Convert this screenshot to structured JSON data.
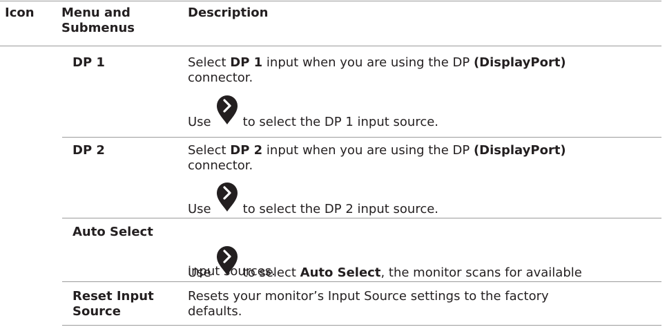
{
  "header": {
    "icon": "Icon",
    "menu": "Menu and Submenus",
    "description": "Description"
  },
  "rows": [
    {
      "menu": "DP 1",
      "desc1_pre": "Select ",
      "desc1_bold": "DP 1",
      "desc1_mid": " input when you are using the DP ",
      "desc1_bold2": "(DisplayPort)",
      "desc1_line2": "connector.",
      "use_pre": "Use",
      "use_post": "to select the DP 1 input source."
    },
    {
      "menu": "DP 2",
      "desc1_pre": "Select ",
      "desc1_bold": "DP 2",
      "desc1_mid": " input when you are using the DP ",
      "desc1_bold2": "(DisplayPort)",
      "desc1_line2": "connector.",
      "use_pre": "Use",
      "use_post": "to select the DP 2 input source."
    },
    {
      "menu": "Auto Select",
      "use_pre": "Use",
      "use_mid": "to select ",
      "use_bold": "Auto Select",
      "use_post": ", the monitor scans for available",
      "line2": "input sources."
    },
    {
      "menu_line1": "Reset Input",
      "menu_line2": "Source",
      "desc_line1": "Resets your monitor’s Input Source settings to the factory",
      "desc_line2": "defaults."
    }
  ],
  "icons": {
    "pin": "right-arrow-pin-icon"
  },
  "colors": {
    "text": "#231f20",
    "rule": "#9a9a9a",
    "icon": "#231f20"
  }
}
